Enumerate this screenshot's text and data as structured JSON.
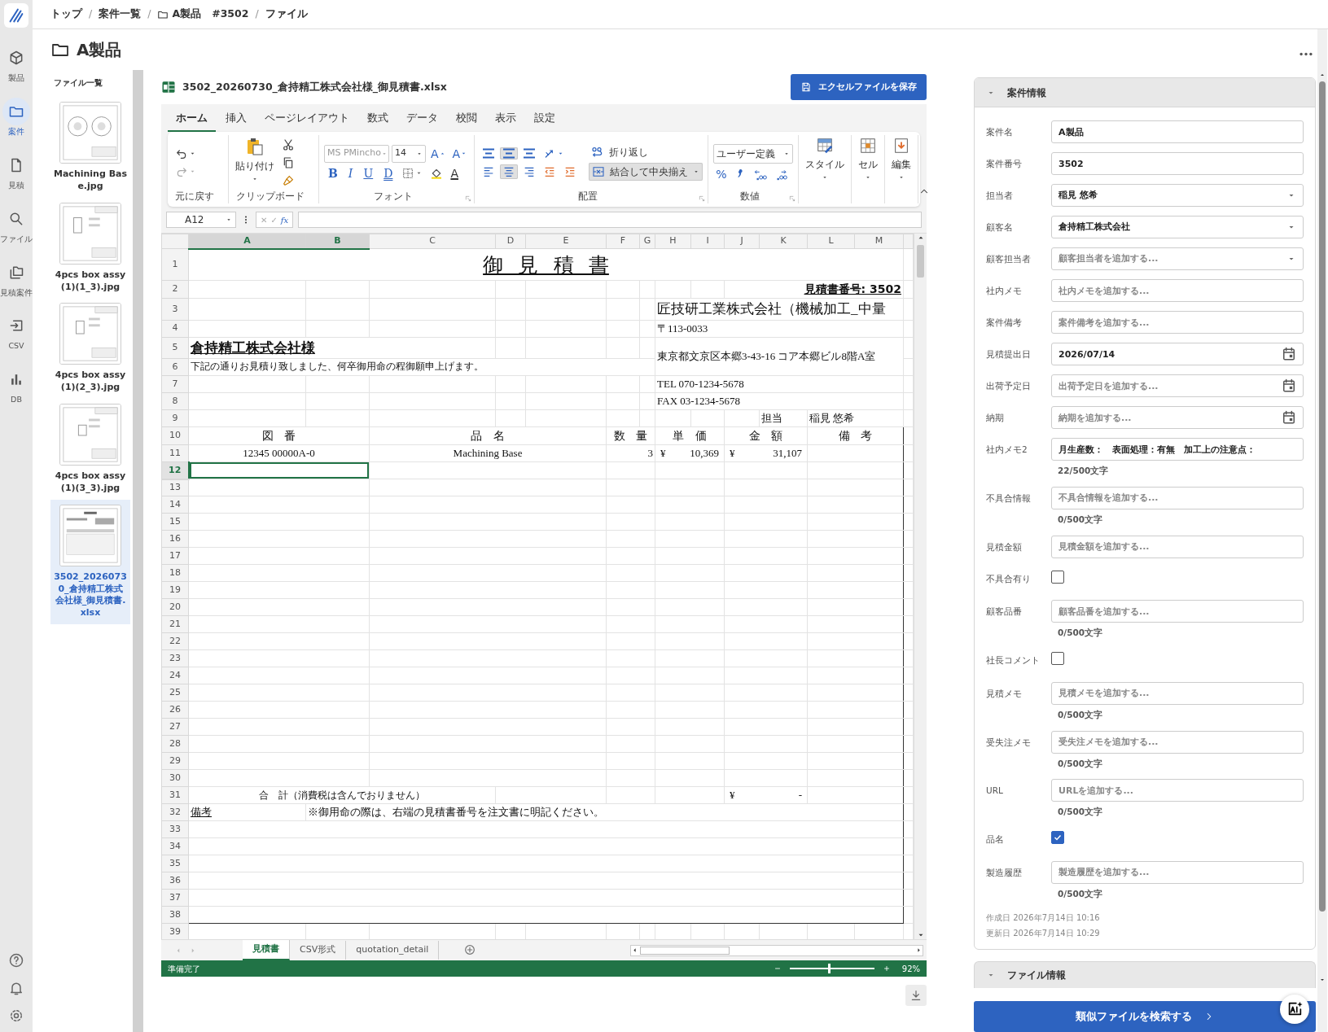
{
  "rail": {
    "items": [
      {
        "label": "製品",
        "selected": false
      },
      {
        "label": "案件",
        "selected": true
      },
      {
        "label": "見積",
        "selected": false
      },
      {
        "label": "ファイル",
        "selected": false
      },
      {
        "label": "見積案件",
        "selected": false
      },
      {
        "label": "CSV",
        "selected": false
      },
      {
        "label": "DB",
        "selected": false
      }
    ]
  },
  "breadcrumb": [
    {
      "label": "トップ",
      "kind": "link"
    },
    {
      "label": "/",
      "kind": "separator"
    },
    {
      "label": "案件一覧",
      "kind": "link"
    },
    {
      "label": "/",
      "kind": "separator"
    },
    {
      "label": "A製品",
      "suffix": "#3502",
      "kind": "folder"
    },
    {
      "label": "/",
      "kind": "separator"
    },
    {
      "label": "ファイル",
      "kind": "link"
    }
  ],
  "page_title": "A製品",
  "file_list": {
    "title": "ファイル一覧",
    "items": [
      {
        "label": "Machining Base.jpg",
        "selected": false
      },
      {
        "label": "4pcs box assy (1)(1_3).jpg",
        "selected": false
      },
      {
        "label": "4pcs box assy (1)(2_3).jpg",
        "selected": false
      },
      {
        "label": "4pcs box assy (1)(3_3).jpg",
        "selected": false
      },
      {
        "label": "3502_20260730_倉持精工株式会社様_御見積書.xlsx",
        "selected": true
      }
    ]
  },
  "workbook": {
    "file_name": "3502_20260730_倉持精工株式会社様_御見積書.xlsx",
    "save_button": "エクセルファイルを保存",
    "ribbon": {
      "tabs": [
        {
          "label": "ホーム",
          "selected": true
        },
        {
          "label": "挿入",
          "selected": false
        },
        {
          "label": "ページレイアウト",
          "selected": false
        },
        {
          "label": "数式",
          "selected": false
        },
        {
          "label": "データ",
          "selected": false
        },
        {
          "label": "校閲",
          "selected": false
        },
        {
          "label": "表示",
          "selected": false
        },
        {
          "label": "設定",
          "selected": false
        }
      ],
      "undo_label": "元に戻す",
      "paste": "貼り付け",
      "clipboard_label": "クリップボード",
      "font_name": "MS PMincho",
      "font_size": "14",
      "font_grow": "A",
      "font_shrink": "A",
      "font_styles": [
        "B",
        "I",
        "U",
        "D"
      ],
      "font_color": "A",
      "font_label": "フォント",
      "vertical_align": [
        {
          "selected": false
        },
        {
          "selected": true
        },
        {
          "selected": false
        }
      ],
      "horizontal_align": [
        {
          "selected": false
        },
        {
          "selected": true
        },
        {
          "selected": false
        }
      ],
      "wrap": "折り返し",
      "merge": "結合して中央揃え",
      "alignment_label": "配置",
      "number_format": "ユーザー定義",
      "percent": "%",
      "number_label": "数値",
      "big_buttons": [
        "スタイル",
        "セル",
        "編集"
      ]
    },
    "formula_bar": {
      "cell_ref": "A12",
      "cancel": "✕",
      "confirm": "✓",
      "function": "fx"
    },
    "columns": [
      {
        "label": "A",
        "selected": true
      },
      {
        "label": "B",
        "selected": true
      },
      {
        "label": "C",
        "selected": false
      },
      {
        "label": "D",
        "selected": false
      },
      {
        "label": "E",
        "selected": false
      },
      {
        "label": "F",
        "selected": false
      },
      {
        "label": "G",
        "selected": false
      },
      {
        "label": "H",
        "selected": false
      },
      {
        "label": "I",
        "selected": false
      },
      {
        "label": "J",
        "selected": false
      },
      {
        "label": "K",
        "selected": false
      },
      {
        "label": "L",
        "selected": false
      },
      {
        "label": "M",
        "selected": false
      }
    ],
    "rows": [
      {
        "number": "1",
        "selected": false,
        "cells": [
          {
            "text": "御 見 積 書"
          }
        ]
      },
      {
        "number": "2",
        "selected": false,
        "cells": [
          {
            "text": "見積書番号: 3502"
          }
        ]
      },
      {
        "number": "3",
        "selected": false,
        "cells": [
          {
            "text": "匠技研工業株式会社（機械加工_中量"
          }
        ]
      },
      {
        "number": "4",
        "selected": false,
        "cells": [
          {
            "text": "〒113-0033"
          }
        ]
      },
      {
        "number": "5",
        "selected": false,
        "cells": [
          {
            "text": "倉持精工株式会社様"
          },
          {
            "text": "東京都文京区本郷3-43-16 コア本郷ビル8階A室"
          }
        ]
      },
      {
        "number": "6",
        "selected": false,
        "cells": [
          {
            "text": "下記の通りお見積り致しました、何卒御用命の程御願申上げます。"
          }
        ]
      },
      {
        "number": "7",
        "selected": false,
        "cells": [
          {
            "text": "TEL 070-1234-5678"
          }
        ]
      },
      {
        "number": "8",
        "selected": false,
        "cells": [
          {
            "text": "FAX 03-1234-5678"
          }
        ]
      },
      {
        "number": "9",
        "selected": false,
        "cells": [
          {
            "text": "担当"
          },
          {
            "text": "稲見 悠希"
          }
        ]
      },
      {
        "number": "10",
        "selected": false,
        "cells": [
          {
            "text": "図 番"
          },
          {
            "text": "品 名"
          },
          {
            "text": "数 量"
          },
          {
            "text": "単 価"
          },
          {
            "text": "金 額"
          },
          {
            "text": "備 考"
          }
        ]
      },
      {
        "number": "11",
        "selected": false,
        "cells": [
          {
            "text": "12345 00000A-0"
          },
          {
            "text": "Machining Base"
          },
          {
            "text": "3"
          },
          {
            "symbol": "¥",
            "amount": "10,369"
          },
          {
            "symbol": "¥",
            "amount": "31,107"
          }
        ]
      },
      {
        "number": "12",
        "selected": true
      },
      {
        "number": "13",
        "selected": false
      },
      {
        "number": "14",
        "selected": false
      },
      {
        "number": "15",
        "selected": false
      },
      {
        "number": "16",
        "selected": false
      },
      {
        "number": "17",
        "selected": false
      },
      {
        "number": "18",
        "selected": false
      },
      {
        "number": "19",
        "selected": false
      },
      {
        "number": "20",
        "selected": false
      },
      {
        "number": "21",
        "selected": false
      },
      {
        "number": "22",
        "selected": false
      },
      {
        "number": "23",
        "selected": false
      },
      {
        "number": "24",
        "selected": false
      },
      {
        "number": "25",
        "selected": false
      },
      {
        "number": "26",
        "selected": false
      },
      {
        "number": "27",
        "selected": false
      },
      {
        "number": "28",
        "selected": false
      },
      {
        "number": "29",
        "selected": false
      },
      {
        "number": "30",
        "selected": false
      },
      {
        "number": "31",
        "selected": false,
        "cells": [
          {
            "text": "合　計（消費税は含んでおりません）"
          },
          {
            "symbol": "¥",
            "amount": "-"
          }
        ]
      },
      {
        "number": "32",
        "selected": false,
        "cells": [
          {
            "text": "備考"
          },
          {
            "text": "※御用命の際は、右端の見積書番号を注文書に明記ください。"
          }
        ]
      },
      {
        "number": "33",
        "selected": false
      },
      {
        "number": "34",
        "selected": false
      },
      {
        "number": "35",
        "selected": false
      },
      {
        "number": "36",
        "selected": false
      },
      {
        "number": "37",
        "selected": false
      },
      {
        "number": "38",
        "selected": false
      },
      {
        "number": "39",
        "selected": false
      }
    ],
    "sheet_tabs": [
      {
        "label": "見積書",
        "selected": true
      },
      {
        "label": "CSV形式",
        "selected": false
      },
      {
        "label": "quotation_detail",
        "selected": false
      }
    ],
    "status": "準備完了",
    "zoom": {
      "level": 0.45,
      "reading": "92%"
    }
  },
  "case_info": {
    "title": "案件情報",
    "fields": [
      {
        "label": "案件名",
        "kind": "text",
        "value": "A製品"
      },
      {
        "label": "案件番号",
        "kind": "text",
        "value": "3502"
      },
      {
        "label": "担当者",
        "kind": "select",
        "value": "稲見 悠希"
      },
      {
        "label": "顧客名",
        "kind": "select",
        "value": "倉持精工株式会社"
      },
      {
        "label": "顧客担当者",
        "kind": "select",
        "placeholder": "顧客担当者を追加する..."
      },
      {
        "label": "社内メモ",
        "kind": "text",
        "placeholder": "社内メモを追加する..."
      },
      {
        "label": "案件備考",
        "kind": "text",
        "placeholder": "案件備考を追加する..."
      },
      {
        "label": "見積提出日",
        "kind": "date",
        "value": "2026/07/14"
      },
      {
        "label": "出荷予定日",
        "kind": "date",
        "placeholder": "出荷予定日を追加する..."
      },
      {
        "label": "納期",
        "kind": "date",
        "placeholder": "納期を追加する..."
      },
      {
        "label": "社内メモ2",
        "kind": "text",
        "value": "月生産数：　表面処理：有無　加工上の注意点：",
        "counter": "22/500文字"
      },
      {
        "label": "不具合情報",
        "kind": "text",
        "placeholder": "不具合情報を追加する...",
        "counter": "0/500文字"
      },
      {
        "label": "見積金額",
        "kind": "text",
        "placeholder": "見積金額を追加する..."
      },
      {
        "label": "不具合有り",
        "kind": "checkbox",
        "checked": false
      },
      {
        "label": "顧客品番",
        "kind": "text",
        "placeholder": "顧客品番を追加する...",
        "counter": "0/500文字"
      },
      {
        "label": "社長コメント",
        "kind": "checkbox",
        "checked": false
      },
      {
        "label": "見積メモ",
        "kind": "text",
        "placeholder": "見積メモを追加する...",
        "counter": "0/500文字"
      },
      {
        "label": "受失注メモ",
        "kind": "text",
        "placeholder": "受失注メモを追加する...",
        "counter": "0/500文字"
      },
      {
        "label": "URL",
        "kind": "text",
        "placeholder": "URLを追加する...",
        "counter": "0/500文字"
      },
      {
        "label": "品名",
        "kind": "checkbox",
        "checked": true
      },
      {
        "label": "製造履歴",
        "kind": "text",
        "placeholder": "製造履歴を追加する...",
        "counter": "0/500文字"
      }
    ],
    "created": "作成日 2026年7月14日 10:16",
    "updated": "更新日 2026年7月14日 10:29"
  },
  "file_info": {
    "title": "ファイル情報"
  },
  "search_button": "類似ファイルを検索する"
}
